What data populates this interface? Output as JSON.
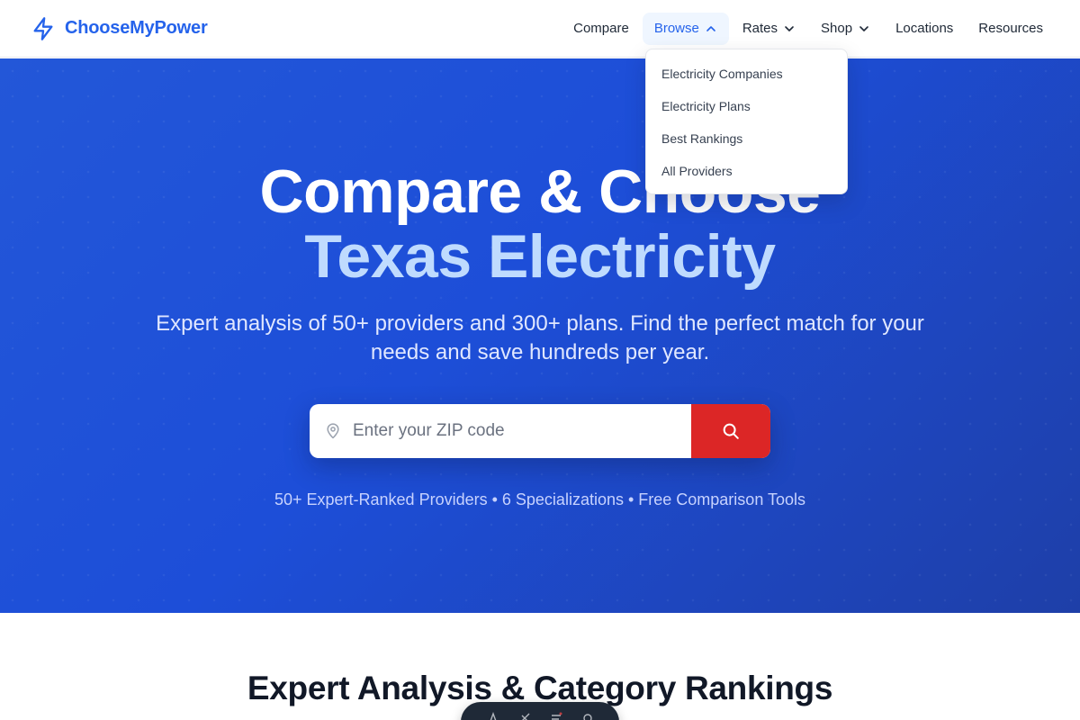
{
  "brand": {
    "name": "ChooseMyPower"
  },
  "nav": {
    "items": [
      {
        "label": "Compare",
        "has_chevron": false
      },
      {
        "label": "Browse",
        "has_chevron": true,
        "active": true
      },
      {
        "label": "Rates",
        "has_chevron": true
      },
      {
        "label": "Shop",
        "has_chevron": true
      },
      {
        "label": "Locations",
        "has_chevron": false
      },
      {
        "label": "Resources",
        "has_chevron": false
      }
    ]
  },
  "browse_menu": {
    "items": [
      {
        "label": "Electricity Companies"
      },
      {
        "label": "Electricity Plans"
      },
      {
        "label": "Best Rankings"
      },
      {
        "label": "All Providers"
      }
    ]
  },
  "hero": {
    "title_line1": "Compare & Choose",
    "title_line2": "Texas Electricity",
    "subtitle": "Expert analysis of 50+ providers and 300+ plans. Find the perfect match for your needs and save hundreds per year.",
    "search": {
      "placeholder": "Enter your ZIP code",
      "value": ""
    },
    "stats": "50+ Expert-Ranked Providers • 6 Specializations • Free Comparison Tools"
  },
  "section": {
    "title": "Expert Analysis & Category Rankings"
  },
  "colors": {
    "brand": "#2563eb",
    "hero_bg": "#1d4ed8",
    "accent_light": "#bfdbfe",
    "search_button": "#dc2626"
  },
  "icons": {
    "brand": "lightning-bolt-icon",
    "chevron": "chevron-down-icon",
    "chevron_up": "chevron-up-icon",
    "pin": "map-pin-icon",
    "search": "search-icon"
  }
}
